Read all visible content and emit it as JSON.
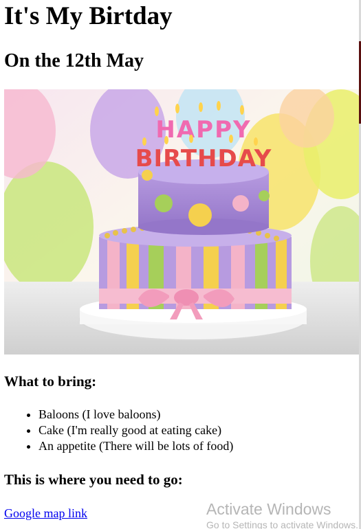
{
  "header": {
    "title": "It's My Birtday",
    "subtitle": "On the 12th May"
  },
  "photo": {
    "alt": "Birthday cake with candles spelling HAPPY BIRTHDAY",
    "candles_top": "HAPPY",
    "candles_bottom": "BIRTHDAY"
  },
  "bring": {
    "heading": "What to bring:",
    "items": [
      "Baloons (I love baloons)",
      "Cake (I'm really good at eating cake)",
      "An appetite (There will be lots of food)"
    ]
  },
  "directions": {
    "heading": "This is where you need to go:",
    "link_text": "Google map link"
  },
  "watermark": {
    "line1": "Activate Windows",
    "line2": "Go to Settings to activate Windows."
  },
  "colors": {
    "link": "#0000ee",
    "cake_purple": "#a98bd6",
    "cake_pink": "#f4b3c8",
    "cake_yellow": "#f5d04e",
    "cake_green": "#a6cf5a"
  }
}
